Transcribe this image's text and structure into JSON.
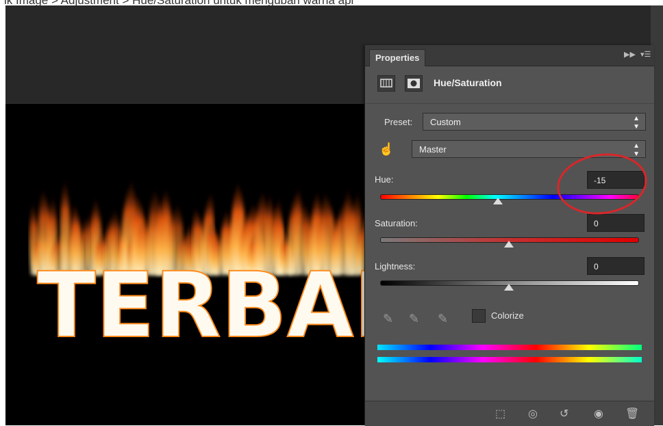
{
  "caption": "ik Image > Adjustment > Hue/Saturation untuk mengubah warna api",
  "panel": {
    "tab_label": "Properties",
    "collapse_icon": "double-arrow-icon",
    "menu_icon": "panel-menu-icon",
    "title": "Hue/Saturation",
    "preset_label": "Preset:",
    "preset_value": "Custom",
    "channel_value": "Master",
    "hue_label": "Hue:",
    "hue_value": "-15",
    "saturation_label": "Saturation:",
    "saturation_value": "0",
    "lightness_label": "Lightness:",
    "lightness_value": "0",
    "colorize_label": "Colorize",
    "colorize_checked": false
  },
  "canvas": {
    "text": "TERBAK"
  },
  "colors": {
    "accent_annotation": "#d9262a",
    "panel_bg": "#535353",
    "workspace_bg": "#282828"
  },
  "slider_levels": {
    "hue": -15,
    "saturation": 0,
    "lightness": 0
  }
}
